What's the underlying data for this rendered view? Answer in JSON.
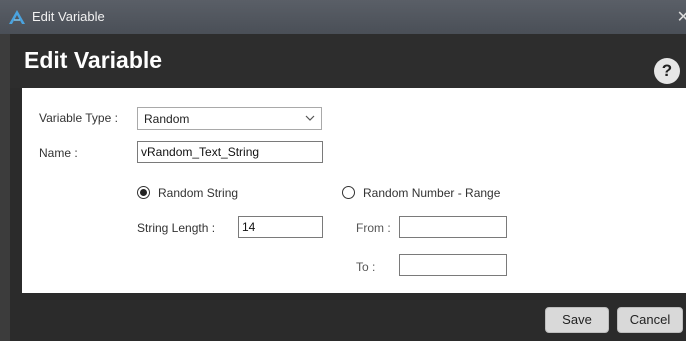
{
  "window": {
    "title": "Edit Variable"
  },
  "header": {
    "heading": "Edit Variable",
    "help_label": "?"
  },
  "form": {
    "variable_type_label": "Variable Type :",
    "variable_type_value": "Random",
    "name_label": "Name :",
    "name_value": "vRandom_Text_String",
    "option_random_string": {
      "label": "Random String",
      "selected": true
    },
    "option_random_number": {
      "label": "Random Number - Range",
      "selected": false
    },
    "string_length_label": "String Length :",
    "string_length_value": "14",
    "from_label": "From :",
    "from_value": "",
    "to_label": "To :",
    "to_value": ""
  },
  "footer": {
    "save_label": "Save",
    "cancel_label": "Cancel"
  },
  "colors": {
    "accent_icon": "#4aa3df",
    "title_bar": "#52575f",
    "background": "#2b2b2b",
    "panel": "#ffffff"
  }
}
